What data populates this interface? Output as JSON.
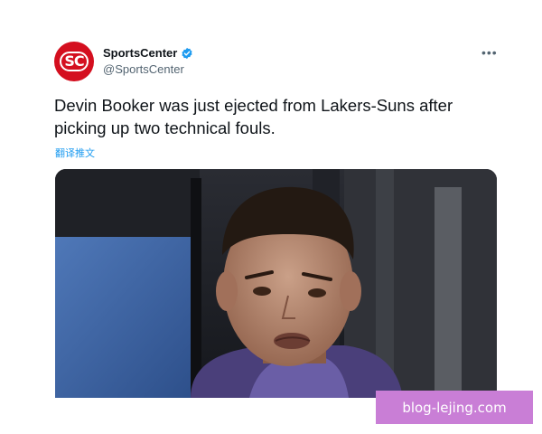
{
  "tweet": {
    "avatar_text": "SC",
    "display_name": "SportsCenter",
    "handle": "@SportsCenter",
    "more_label": "•••",
    "text": "Devin Booker was just ejected from Lakers-Suns after picking up two technical fouls.",
    "translate_label": "翻译推文",
    "media": {
      "icon": "photo-of-player"
    }
  },
  "watermark": {
    "text": "blog-lejing.com"
  },
  "colors": {
    "brand": "#d40f1f",
    "verified": "#1d9bf0",
    "link": "#1d9bf0",
    "watermark_bg": "#c97ed6"
  }
}
